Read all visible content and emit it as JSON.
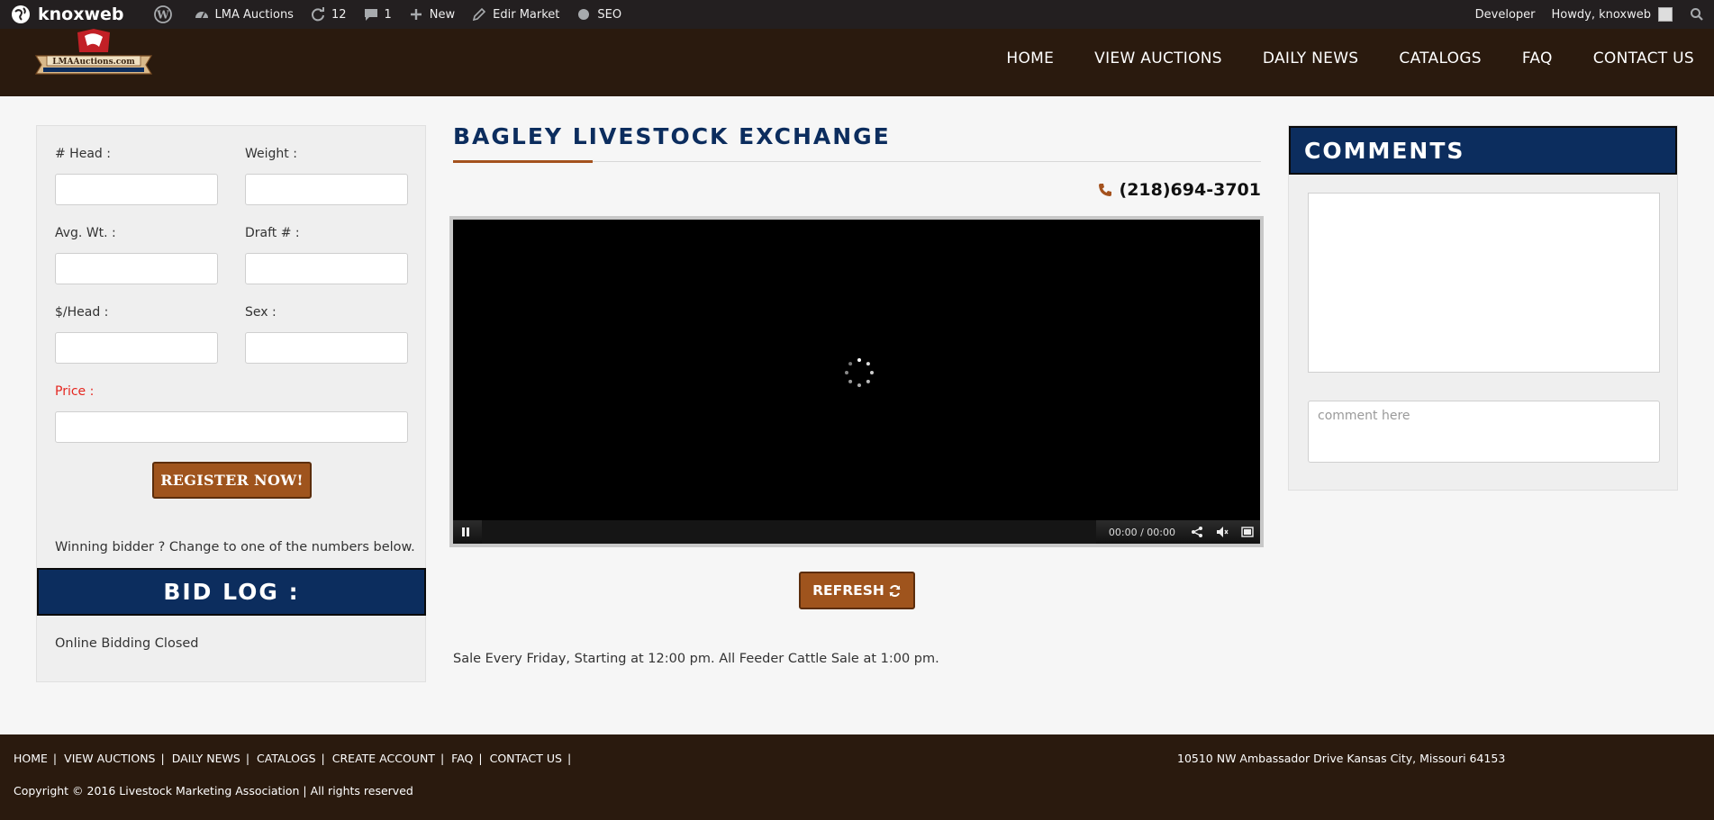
{
  "adminbar": {
    "site_name": "knoxweb",
    "items": [
      {
        "label": "LMA Auctions"
      },
      {
        "label": "12"
      },
      {
        "label": "1"
      },
      {
        "label": "New"
      },
      {
        "label": "Edir Market"
      },
      {
        "label": "SEO"
      }
    ],
    "developer": "Developer",
    "howdy": "Howdy, knoxweb"
  },
  "header": {
    "logo_text": "LMAAuctions.com",
    "nav": [
      "HOME",
      "VIEW AUCTIONS",
      "DAILY NEWS",
      "CATALOGS",
      "FAQ",
      "CONTACT US"
    ]
  },
  "form": {
    "head_label": "# Head :",
    "weight_label": "Weight :",
    "avg_wt_label": "Avg. Wt. :",
    "draft_label": "Draft # :",
    "per_head_label": "$/Head :",
    "sex_label": "Sex :",
    "price_label": "Price :",
    "register_label": "REGISTER NOW!",
    "winning_text": "Winning bidder ? Change to one of the numbers below.",
    "bidlog_title": "BID LOG :",
    "bidding_status": "Online Bidding Closed"
  },
  "auction": {
    "title": "BAGLEY LIVESTOCK EXCHANGE",
    "phone": "(218)694-3701",
    "video_time": "00:00 / 00:00",
    "refresh_label": "REFRESH",
    "sale_text": "Sale Every Friday, Starting at 12:00 pm. All Feeder Cattle Sale at 1:00 pm."
  },
  "comments": {
    "title": "COMMENTS",
    "placeholder": "comment here"
  },
  "footer": {
    "nav": [
      "HOME",
      "VIEW AUCTIONS",
      "DAILY NEWS",
      "CATALOGS",
      "CREATE ACCOUNT",
      "FAQ",
      "CONTACT US"
    ],
    "address": "10510 NW Ambassador Drive Kansas City, Missouri 64153",
    "copyright": "Copyright © 2016 Livestock Marketing Association | All rights reserved"
  },
  "colors": {
    "navy": "#0c2d5e",
    "brown": "#9f541d",
    "header_bg": "#2a1a0e",
    "price_red": "#e5261f"
  }
}
